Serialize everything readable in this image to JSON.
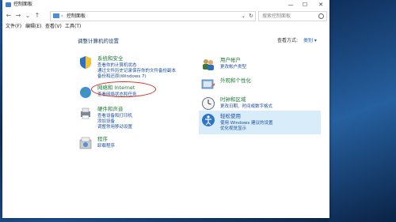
{
  "window": {
    "title": "控制面板",
    "minimize": "—",
    "maximize": "☐",
    "close": "✕"
  },
  "nav": {
    "back": "←",
    "forward": "→",
    "recent": "⌄",
    "up": "↑"
  },
  "address": {
    "separator": "›",
    "path": "控制面板",
    "dropdown": "⌄",
    "refresh": "↻"
  },
  "search": {
    "placeholder": "搜索控制面板"
  },
  "menu": [
    "文件(F)",
    "编辑(E)",
    "查看(V)",
    "工具(T)"
  ],
  "page": {
    "title": "调整计算机的设置",
    "view_label": "查看方式:",
    "view_value": "类别 ▾"
  },
  "categories": {
    "system": {
      "title": "系统和安全",
      "links": [
        "查看你的计算机状态",
        "通过文件历史记录保存你的文件备份副本",
        "备份和还原(Windows 7)"
      ],
      "icon": "shield-icon"
    },
    "network": {
      "title": "网络和 Internet",
      "links": [
        "查看网络状态和任务"
      ],
      "icon": "globe-icon"
    },
    "hardware": {
      "title": "硬件和声音",
      "links": [
        "查看设备和打印机",
        "添加设备",
        "调整常用移动设置"
      ],
      "icon": "printer-icon"
    },
    "programs": {
      "title": "程序",
      "links": [
        "卸载程序"
      ],
      "icon": "programs-icon"
    },
    "users": {
      "title": "用户帐户",
      "links": [
        "更改帐户类型"
      ],
      "icon": "users-icon"
    },
    "appearance": {
      "title": "外观和个性化",
      "links": [],
      "icon": "appearance-icon"
    },
    "clock": {
      "title": "时钟和区域",
      "links": [
        "更改日期、时间或数字格式"
      ],
      "icon": "clock-icon"
    },
    "ease": {
      "title": "轻松使用",
      "links": [
        "使用 Windows 建议的设置",
        "优化视觉显示"
      ],
      "icon": "ease-of-access-icon"
    }
  },
  "colors": {
    "category_title": "#1e7a35",
    "link": "#1a4fa3",
    "annotation_circle": "#d9261c",
    "hover_highlight": "#d9ecf9"
  }
}
